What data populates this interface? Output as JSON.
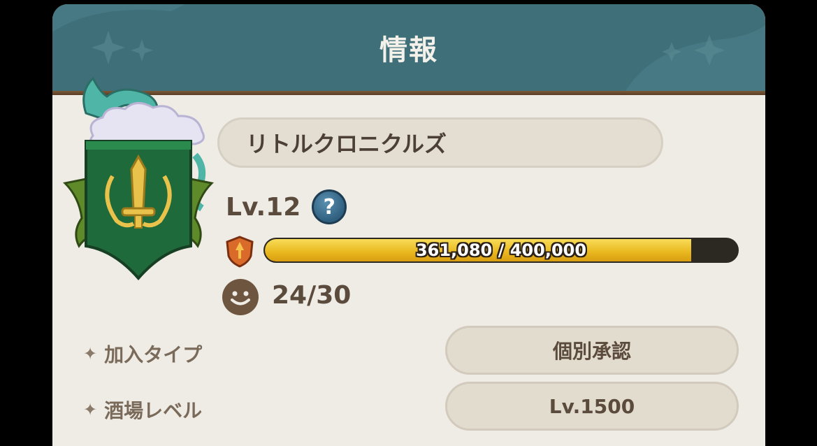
{
  "header": {
    "title": "情報"
  },
  "guild": {
    "name": "リトルクロニクルズ",
    "level": "Lv.12",
    "help_icon": "question-icon",
    "exp": {
      "text": "361,080 / 400,000",
      "current": 361080,
      "max": 400000,
      "fraction": 0.9027
    },
    "members": "24/30"
  },
  "info": {
    "join_type_label": "加入タイプ",
    "join_type_value": "個別承認",
    "tavern_level_label": "酒場レベル",
    "tavern_level_value": "Lv.1500",
    "bullet_icon": "sparkle-star-icon"
  },
  "colors": {
    "header": "#3f6f79",
    "panel": "#efece6",
    "xp_fill": "#e9b71e",
    "help": "#2f5f7f",
    "text_dark": "#5b4b3c"
  }
}
